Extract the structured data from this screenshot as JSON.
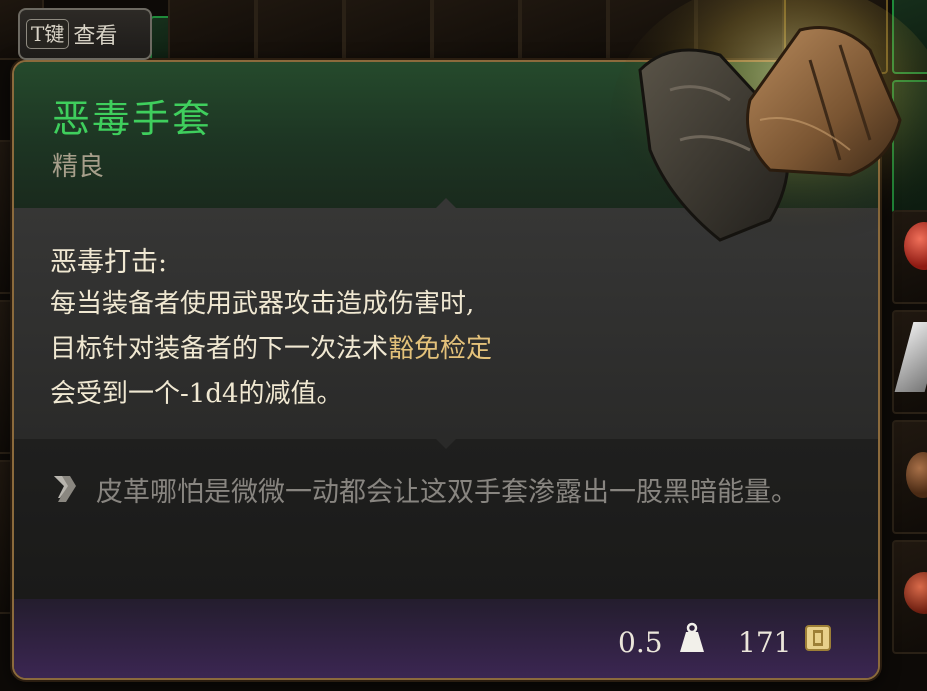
{
  "key_hint": {
    "key": "T键",
    "label": "查看"
  },
  "item": {
    "name": "恶毒手套",
    "rarity": "精良",
    "art_icon": "leather-gloves-icon"
  },
  "effect": {
    "title": "恶毒打击:",
    "line1": "每当装备者使用武器攻击造成伤害时,",
    "line2_pre": "目标针对装备者的下一次法术",
    "line2_keyword": "豁免检定",
    "line3": "会受到一个-1d4的减值。"
  },
  "lore": {
    "icon": "quill-icon",
    "text": "皮革哪怕是微微一动都会让这双手套渗露出一股黑暗能量。"
  },
  "footer": {
    "weight": "0.5",
    "weight_icon": "weight-icon",
    "price": "171",
    "price_icon": "gold-coin-icon"
  },
  "colors": {
    "name_green": "#3fcf5d",
    "keyword_gold": "#e3c17a",
    "border_bronze": "#8b6a3c",
    "footer_purple": "#3b2652"
  }
}
